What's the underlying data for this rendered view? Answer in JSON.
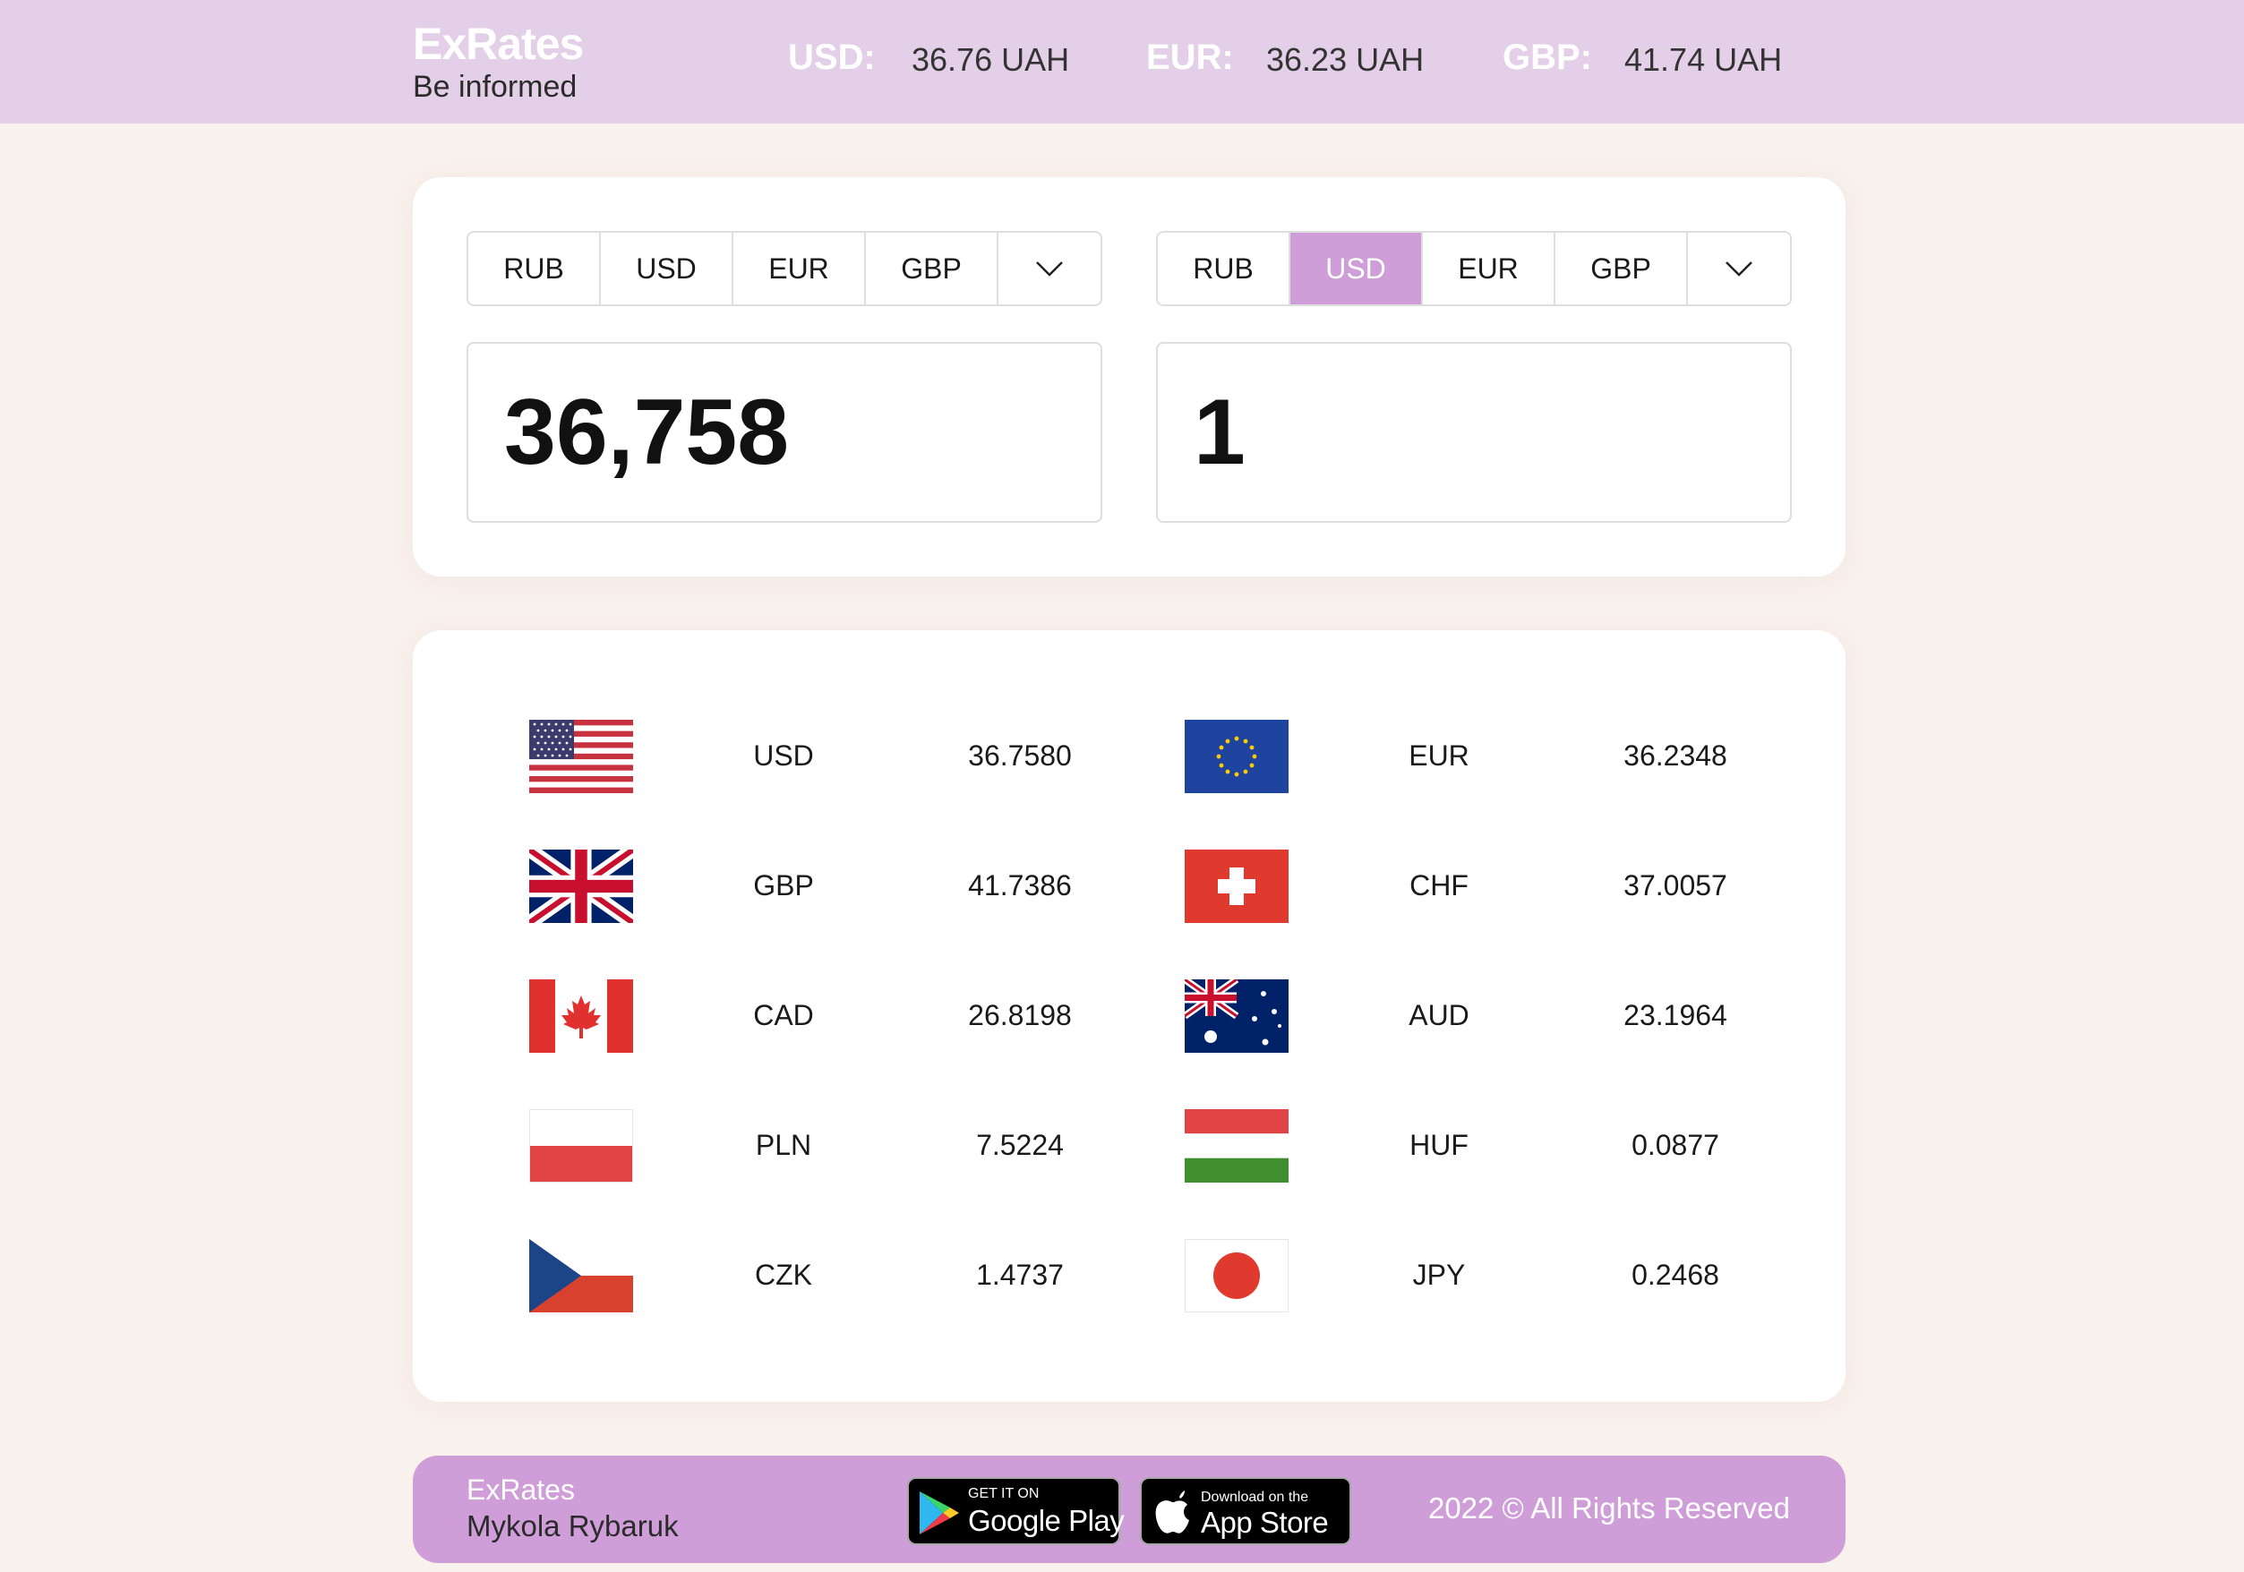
{
  "header": {
    "title": "ExRates",
    "subtitle": "Be informed",
    "rates": [
      {
        "code": "USD:",
        "value": "36.76 UAH"
      },
      {
        "code": "EUR:",
        "value": "36.23 UAH"
      },
      {
        "code": "GBP:",
        "value": "41.74 UAH"
      }
    ]
  },
  "converter": {
    "left": {
      "tabs": [
        "RUB",
        "USD",
        "EUR",
        "GBP"
      ],
      "active": null,
      "amount": "36,758"
    },
    "right": {
      "tabs": [
        "RUB",
        "USD",
        "EUR",
        "GBP"
      ],
      "active": "USD",
      "amount": "1"
    }
  },
  "rates": {
    "left": [
      {
        "code": "USD",
        "value": "36.7580",
        "flag": "us-flag-icon"
      },
      {
        "code": "GBP",
        "value": "41.7386",
        "flag": "uk-flag-icon"
      },
      {
        "code": "CAD",
        "value": "26.8198",
        "flag": "canada-flag-icon"
      },
      {
        "code": "PLN",
        "value": "7.5224",
        "flag": "poland-flag-icon"
      },
      {
        "code": "CZK",
        "value": "1.4737",
        "flag": "czech-flag-icon"
      }
    ],
    "right": [
      {
        "code": "EUR",
        "value": "36.2348",
        "flag": "eu-flag-icon"
      },
      {
        "code": "CHF",
        "value": "37.0057",
        "flag": "swiss-flag-icon"
      },
      {
        "code": "AUD",
        "value": "23.1964",
        "flag": "australia-flag-icon"
      },
      {
        "code": "HUF",
        "value": "0.0877",
        "flag": "hungary-flag-icon"
      },
      {
        "code": "JPY",
        "value": "0.2468",
        "flag": "japan-flag-icon"
      }
    ]
  },
  "footer": {
    "brand": "ExRates",
    "author": "Mykola Rybaruk",
    "google_small": "GET IT ON",
    "google_big": "Google Play",
    "apple_small": "Download on the",
    "apple_big": "App Store",
    "copyright": "2022 © All Rights Reserved"
  },
  "colors": {
    "accent": "#cf9ed9",
    "header_bg": "#e3cfe7",
    "page_bg": "#f9f1ec"
  }
}
